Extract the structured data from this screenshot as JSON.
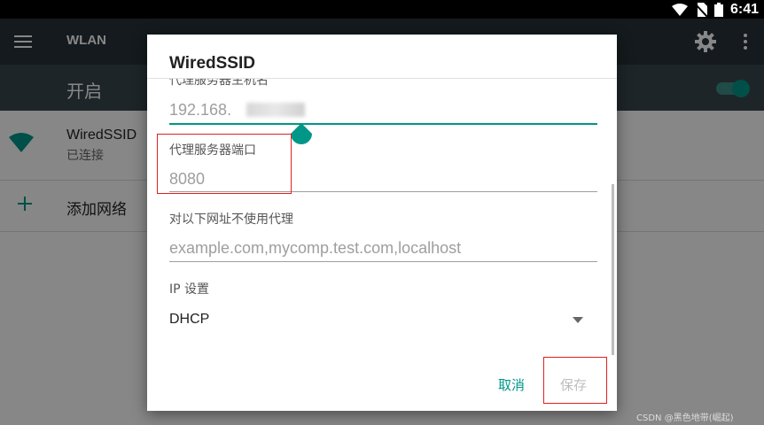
{
  "status_bar": {
    "time": "6:41"
  },
  "toolbar": {
    "title": "WLAN"
  },
  "switch_bar": {
    "label": "开启",
    "enabled": true
  },
  "network": {
    "name": "WiredSSID",
    "status": "已连接"
  },
  "add_network": {
    "label": "添加网络"
  },
  "dialog": {
    "title": "WiredSSID",
    "proxy_host": {
      "label": "代理服务器主机名",
      "value": "192.168."
    },
    "proxy_port": {
      "label": "代理服务器端口",
      "value": "8080"
    },
    "bypass": {
      "label": "对以下网址不使用代理",
      "placeholder": "example.com,mycomp.test.com,localhost"
    },
    "ip_settings": {
      "label": "IP 设置",
      "value": "DHCP"
    },
    "cancel_label": "取消",
    "save_label": "保存"
  },
  "colors": {
    "accent": "#009688",
    "toolbar": "#263238",
    "switchbar": "#37474f",
    "annotation": "#e02020"
  },
  "watermark": "CSDN @黑色地带(崛起)"
}
